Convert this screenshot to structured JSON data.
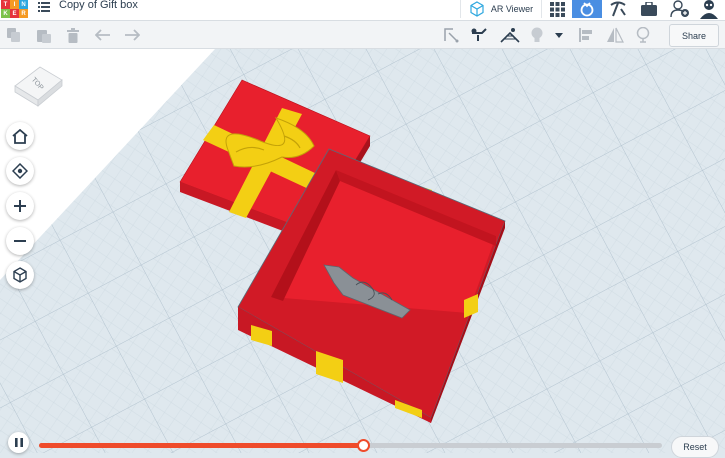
{
  "header": {
    "logo_letters": [
      "T",
      "I",
      "N",
      "K",
      "E",
      "R",
      "C",
      "A",
      "D"
    ],
    "logo_colors": [
      "#e5333b",
      "#f59a23",
      "#2fa8df",
      "#7cc24c",
      "#e5333b",
      "#f59a23",
      "#2fa8df",
      "#7cc24c",
      "#e5333b"
    ],
    "title": "Copy of Gift box",
    "ar_viewer_label": "AR Viewer",
    "active_view_color": "#4a8ee2"
  },
  "toolbar": {
    "share_label": "Share"
  },
  "workplane": {
    "view_cube_label": "TOP",
    "grid_color": "#dfe8ee",
    "box_color": "#e8202d",
    "ribbon_color": "#f3cf14",
    "object_color": "#8a9096"
  },
  "playback": {
    "progress": 0.52,
    "reset_label": "Reset",
    "progress_color": "#ef4b2b"
  }
}
